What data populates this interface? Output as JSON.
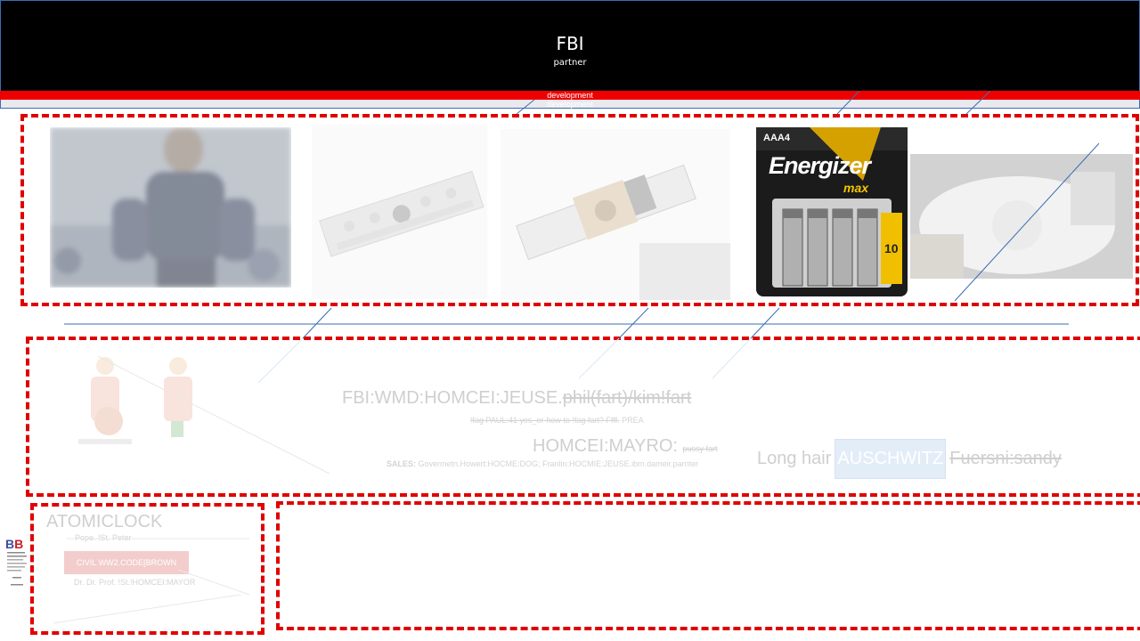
{
  "header": {
    "title": "FBI",
    "subtitle": "partner",
    "bar_label_1": "development",
    "bar_label_2": "development"
  },
  "photos": [
    {
      "icon": "police-officer-photo"
    },
    {
      "icon": "lego-brick-assembly-photo"
    },
    {
      "icon": "lego-mechanism-photo"
    },
    {
      "icon": "battery-pack-photo",
      "brand": "Energizer",
      "size_label": "AAA4",
      "sub_brand": "max",
      "count": "10"
    },
    {
      "icon": "millennium-falcon-model-photo"
    }
  ],
  "middle": {
    "line1_prefix": "FBI:WMD:HOMCEI:JEUSE.",
    "line1_struck": "phil(fart)/kim!fart",
    "line2_struck": "!fag PAUL:41 yes_or-how to !fag fart? Ffff.",
    "line2_tail": "PREA",
    "line3_main": "HOMCEI:MAYRO:",
    "line3_small": "pussy fart",
    "sales_label": "SALES:",
    "sales_text": "Govermetn.Howert:HOCME:DOG; Franlin:HOCMIE:JEUSE.ibm.dameir.parnter",
    "long_hair": "Long hair",
    "highlight": "AUSCHWITZ",
    "struck_name": "Fuersni:sandy"
  },
  "bottom_left": {
    "title": "ATOMICLOCK",
    "pope": "Pope. !St. Peter",
    "button": "CIVIL WW2.CODE[BROWN",
    "doctor": "Dr. Dr. Prof. !St.!HOMCEI:MAYOR"
  },
  "logo": {
    "mark_1": "B",
    "mark_2": "B"
  },
  "colors": {
    "accent_red": "#ee0000",
    "header_black": "#000000",
    "line_blue": "#3b6db3"
  }
}
